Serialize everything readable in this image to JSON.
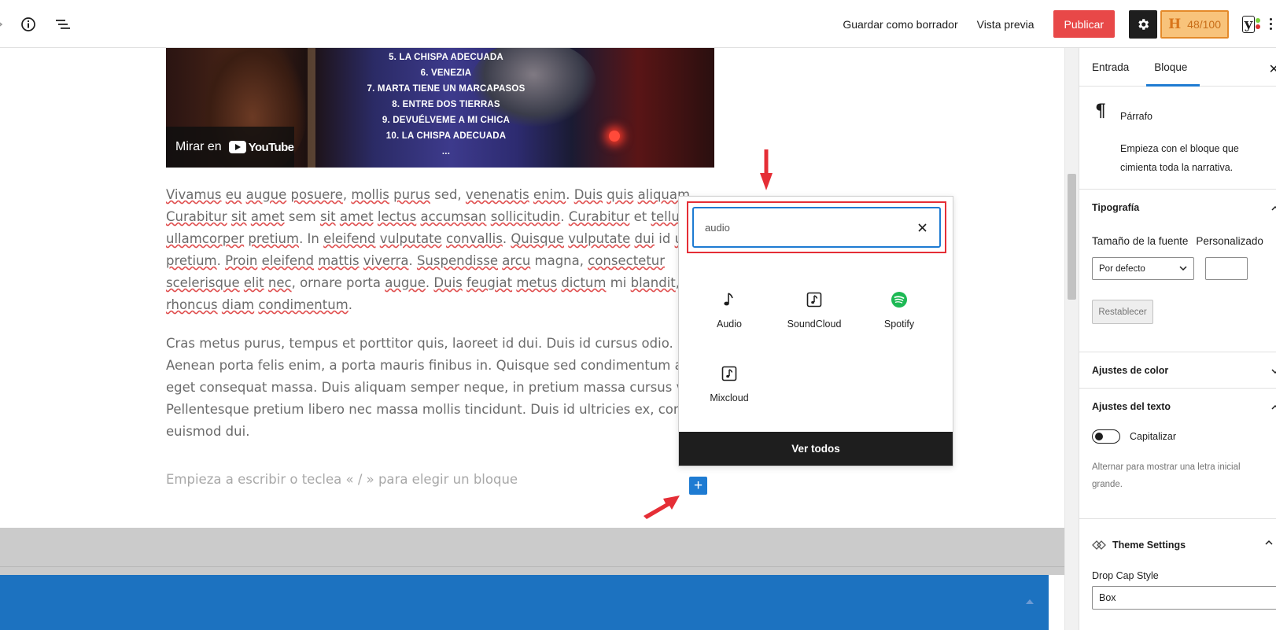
{
  "toolbar": {
    "save_draft": "Guardar como borrador",
    "preview": "Vista previa",
    "publish": "Publicar",
    "seo_score": "48/100",
    "seo_letter": "H",
    "yoast_letter": "y",
    "colors": {
      "publish": "#e84848",
      "accent": "#1e7bd2"
    }
  },
  "video": {
    "tracks": [
      "5. LA CHISPA ADECUADA",
      "6. VENEZIA",
      "7. MARTA TIENE UN MARCAPASOS",
      "8. ENTRE DOS TIERRAS",
      "9. DEVUÉLVEME A MI CHICA",
      "10. LA CHISPA ADECUADA",
      "..."
    ],
    "watch_on": "Mirar en",
    "yt_brand": "YouTube"
  },
  "content": {
    "para1": {
      "l1": {
        "a": "Vivamus",
        "b": " ",
        "c": "eu",
        "d": " ",
        "e": "augue",
        "f": " ",
        "g": "posuere",
        "h": ", ",
        "i": "mollis",
        "j": " ",
        "k": "purus",
        "l": " sed, ",
        "m": "venenatis",
        "n": " ",
        "o": "enim",
        "p": ". ",
        "q": "Duis",
        "r": " ",
        "s": "quis",
        "t": " ",
        "u": "aliquam"
      },
      "l2": {
        "a": "Curabitur",
        "b": " ",
        "c": "sit",
        "d": " ",
        "e": "amet",
        "f": " sem ",
        "g": "sit",
        "h": " ",
        "i": "amet",
        "j": " ",
        "k": "lectus",
        "l": " ",
        "m": "accumsan",
        "n": " ",
        "o": "sollicitudin",
        "p": ". ",
        "q": "Curabitur",
        "r": " et ",
        "s": "tellus",
        "t": " a"
      },
      "l3": {
        "a": "ullamcorper",
        "b": " ",
        "c": "pretium",
        "d": ". In ",
        "e": "eleifend",
        "f": " ",
        "g": "vulputate",
        "h": " ",
        "i": "convallis",
        "j": ". ",
        "k": "Quisque",
        "l": " ",
        "m": "vulputate",
        "n": " ",
        "o": "dui",
        "p": " id ",
        "q": "ult"
      },
      "l4": {
        "a": "pretium",
        "b": ". ",
        "c": "Proin",
        "d": " ",
        "e": "eleifend",
        "f": " ",
        "g": "mattis",
        "h": " ",
        "i": "viverra",
        "j": ". ",
        "k": "Suspendisse",
        "l": " ",
        "m": "arcu",
        "n": " magna, ",
        "o": "consectetur"
      },
      "l5": {
        "a": "scelerisque",
        "b": " ",
        "c": "elit",
        "d": " ",
        "e": "nec",
        "f": ", ornare porta ",
        "g": "augue",
        "h": ". ",
        "i": "Duis",
        "j": " ",
        "k": "feugiat",
        "l": " ",
        "m": "metus",
        "n": " ",
        "o": "dictum",
        "p": " mi ",
        "q": "blandit",
        "r": ", u"
      },
      "l6": {
        "a": "rhoncus",
        "b": " ",
        "c": "diam",
        "d": " ",
        "e": "condimentum",
        "f": "."
      }
    },
    "para2": [
      "Cras metus purus, tempus et porttitor quis, laoreet id dui. Duis id cursus odio.",
      "Aenean porta felis enim, a porta mauris finibus in. Quisque sed condimentum ant",
      "eget consequat massa. Duis aliquam semper neque, in pretium massa cursus vit",
      "Pellentesque pretium libero nec massa mollis tincidunt. Duis id ultricies ex, comn",
      "euismod dui."
    ],
    "placeholder": "Empieza a escribir o teclea « / » para elegir un bloque",
    "add_block": "+"
  },
  "inserter": {
    "search_value": "audio",
    "results": [
      {
        "label": "Audio",
        "icon": "music-note-icon"
      },
      {
        "label": "SoundCloud",
        "icon": "embed-audio-icon"
      },
      {
        "label": "Spotify",
        "icon": "spotify-icon"
      },
      {
        "label": "Mixcloud",
        "icon": "embed-audio-icon"
      }
    ],
    "view_all": "Ver todos"
  },
  "sidebar": {
    "tabs": [
      "Entrada",
      "Bloque"
    ],
    "active_tab": "Bloque",
    "block": {
      "icon": "¶",
      "name": "Párrafo",
      "description": "Empieza con el bloque que cimienta toda la narrativa."
    },
    "typography": {
      "title": "Tipografía",
      "font_size_label": "Tamaño de la fuente",
      "custom_label": "Personalizado",
      "font_size_value": "Por defecto",
      "reset": "Restablecer"
    },
    "color": {
      "title": "Ajustes de color"
    },
    "text": {
      "title": "Ajustes del texto",
      "toggle_label": "Capitalizar",
      "help": "Alternar para mostrar una letra inicial grande."
    },
    "theme": {
      "title": "Theme Settings",
      "drop_cap_label": "Drop Cap Style",
      "drop_cap_value": "Box"
    }
  }
}
